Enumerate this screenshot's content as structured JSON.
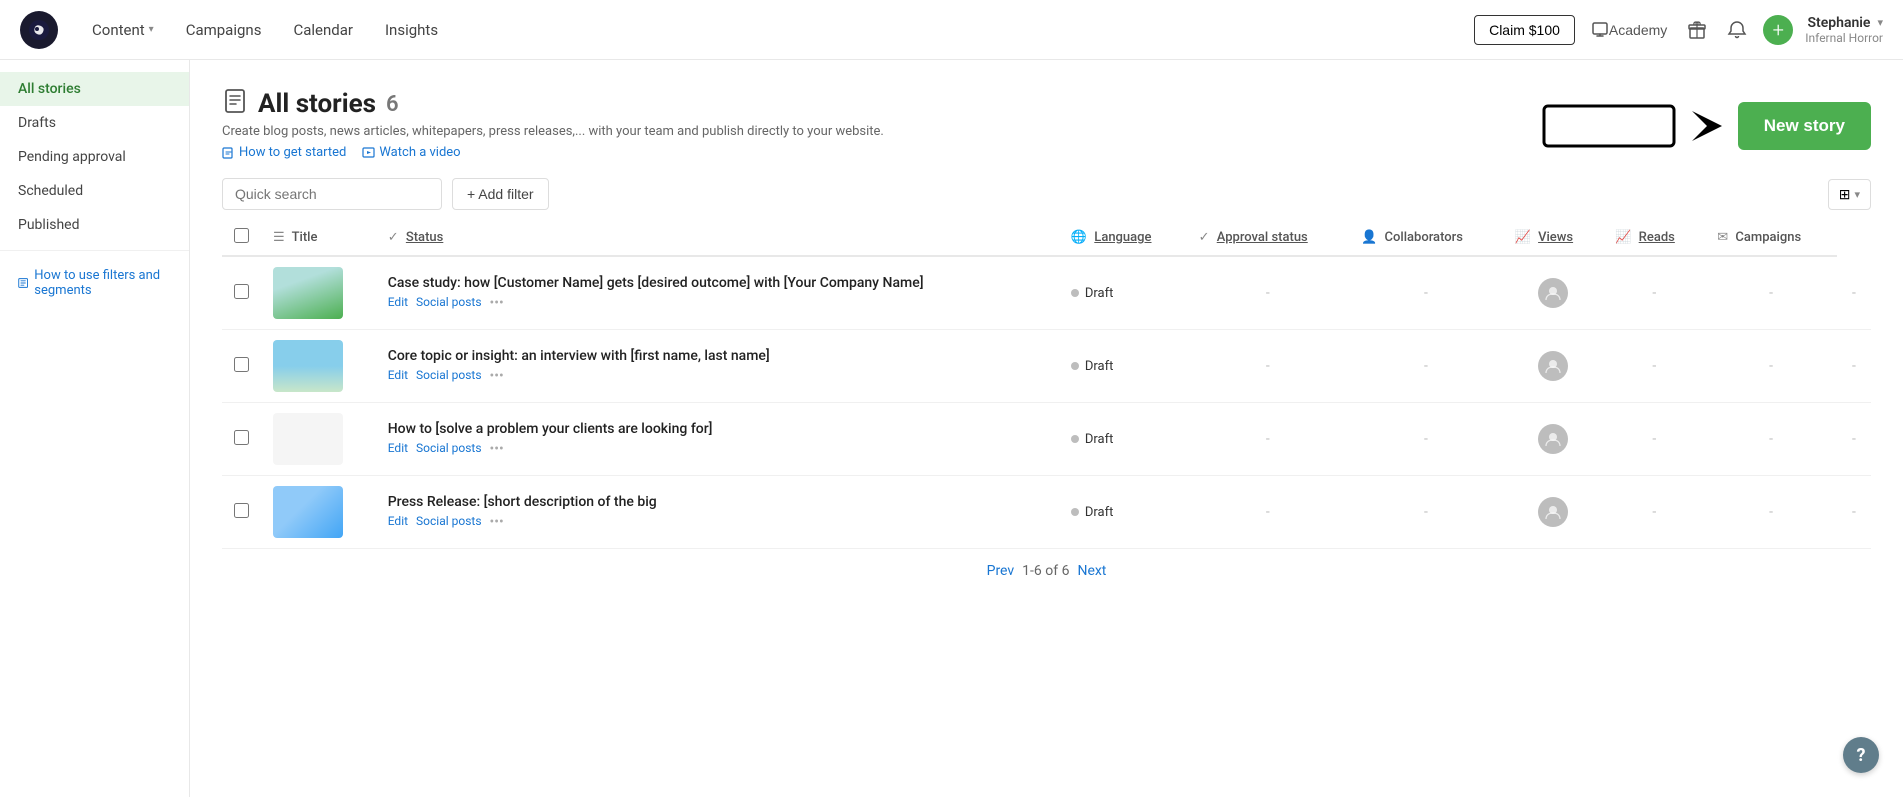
{
  "accent": "#f9a825",
  "topNav": {
    "logo_text": "e",
    "links": [
      {
        "label": "Content",
        "has_dropdown": true
      },
      {
        "label": "Campaigns",
        "has_dropdown": false
      },
      {
        "label": "Calendar",
        "has_dropdown": false
      },
      {
        "label": "Insights",
        "has_dropdown": false
      }
    ],
    "claim_button": "Claim $100",
    "academy_label": "Academy",
    "user_name": "Stephanie",
    "user_sub": "Infernal Horror",
    "plus_icon": "+"
  },
  "sidebar": {
    "items": [
      {
        "label": "All stories",
        "active": true
      },
      {
        "label": "Drafts",
        "active": false
      },
      {
        "label": "Pending approval",
        "active": false
      },
      {
        "label": "Scheduled",
        "active": false
      },
      {
        "label": "Published",
        "active": false
      }
    ],
    "help_link": "How to use filters and segments"
  },
  "main": {
    "page_icon": "📄",
    "page_title": "All stories",
    "story_count": "6",
    "description": "Create blog posts, news articles, whitepapers, press releases,... with your team and publish directly to your website.",
    "link_get_started": "How to get started",
    "link_watch_video": "Watch a video",
    "search_placeholder": "Quick search",
    "add_filter_label": "+ Add filter",
    "new_story_label": "New story",
    "grid_icon": "⊞",
    "columns": [
      {
        "label": "Title",
        "sortable": false,
        "underline": false
      },
      {
        "label": "Status",
        "sortable": true,
        "underline": true
      },
      {
        "label": "Language",
        "sortable": true,
        "underline": true
      },
      {
        "label": "Approval status",
        "sortable": true,
        "underline": true
      },
      {
        "label": "Collaborators",
        "sortable": false,
        "underline": false
      },
      {
        "label": "Views",
        "sortable": true,
        "underline": true
      },
      {
        "label": "Reads",
        "sortable": true,
        "underline": true
      },
      {
        "label": "Campaigns",
        "sortable": false,
        "underline": false
      }
    ],
    "stories": [
      {
        "id": 1,
        "title": "Case study: how [Customer Name] gets [desired outcome] with [Your Company Name]",
        "thumb_type": "green",
        "status": "Draft",
        "language": "-",
        "approval": "-",
        "collaborators": "-",
        "views": "-",
        "reads": "-",
        "campaigns": "-",
        "actions": [
          "Edit",
          "Social posts",
          "..."
        ]
      },
      {
        "id": 2,
        "title": "Core topic or insight: an interview with [first name, last name]",
        "thumb_type": "sky",
        "status": "Draft",
        "language": "-",
        "approval": "-",
        "collaborators": "-",
        "views": "-",
        "reads": "-",
        "campaigns": "-",
        "actions": [
          "Edit",
          "Social posts",
          "..."
        ]
      },
      {
        "id": 3,
        "title": "How to [solve a problem your clients are looking for]",
        "thumb_type": "dots",
        "status": "Draft",
        "language": "-",
        "approval": "-",
        "collaborators": "-",
        "views": "-",
        "reads": "-",
        "campaigns": "-",
        "actions": [
          "Edit",
          "Social posts",
          "..."
        ]
      },
      {
        "id": 4,
        "title": "Press Release: [short description of the big",
        "thumb_type": "photo",
        "status": "Draft",
        "language": "-",
        "approval": "-",
        "collaborators": "-",
        "views": "-",
        "reads": "-",
        "campaigns": "-",
        "actions": [
          "Edit",
          "Social posts",
          "..."
        ]
      }
    ],
    "pagination": {
      "prev": "Prev",
      "next": "Next",
      "range": "1-6 of 6"
    }
  },
  "help_button": "?"
}
